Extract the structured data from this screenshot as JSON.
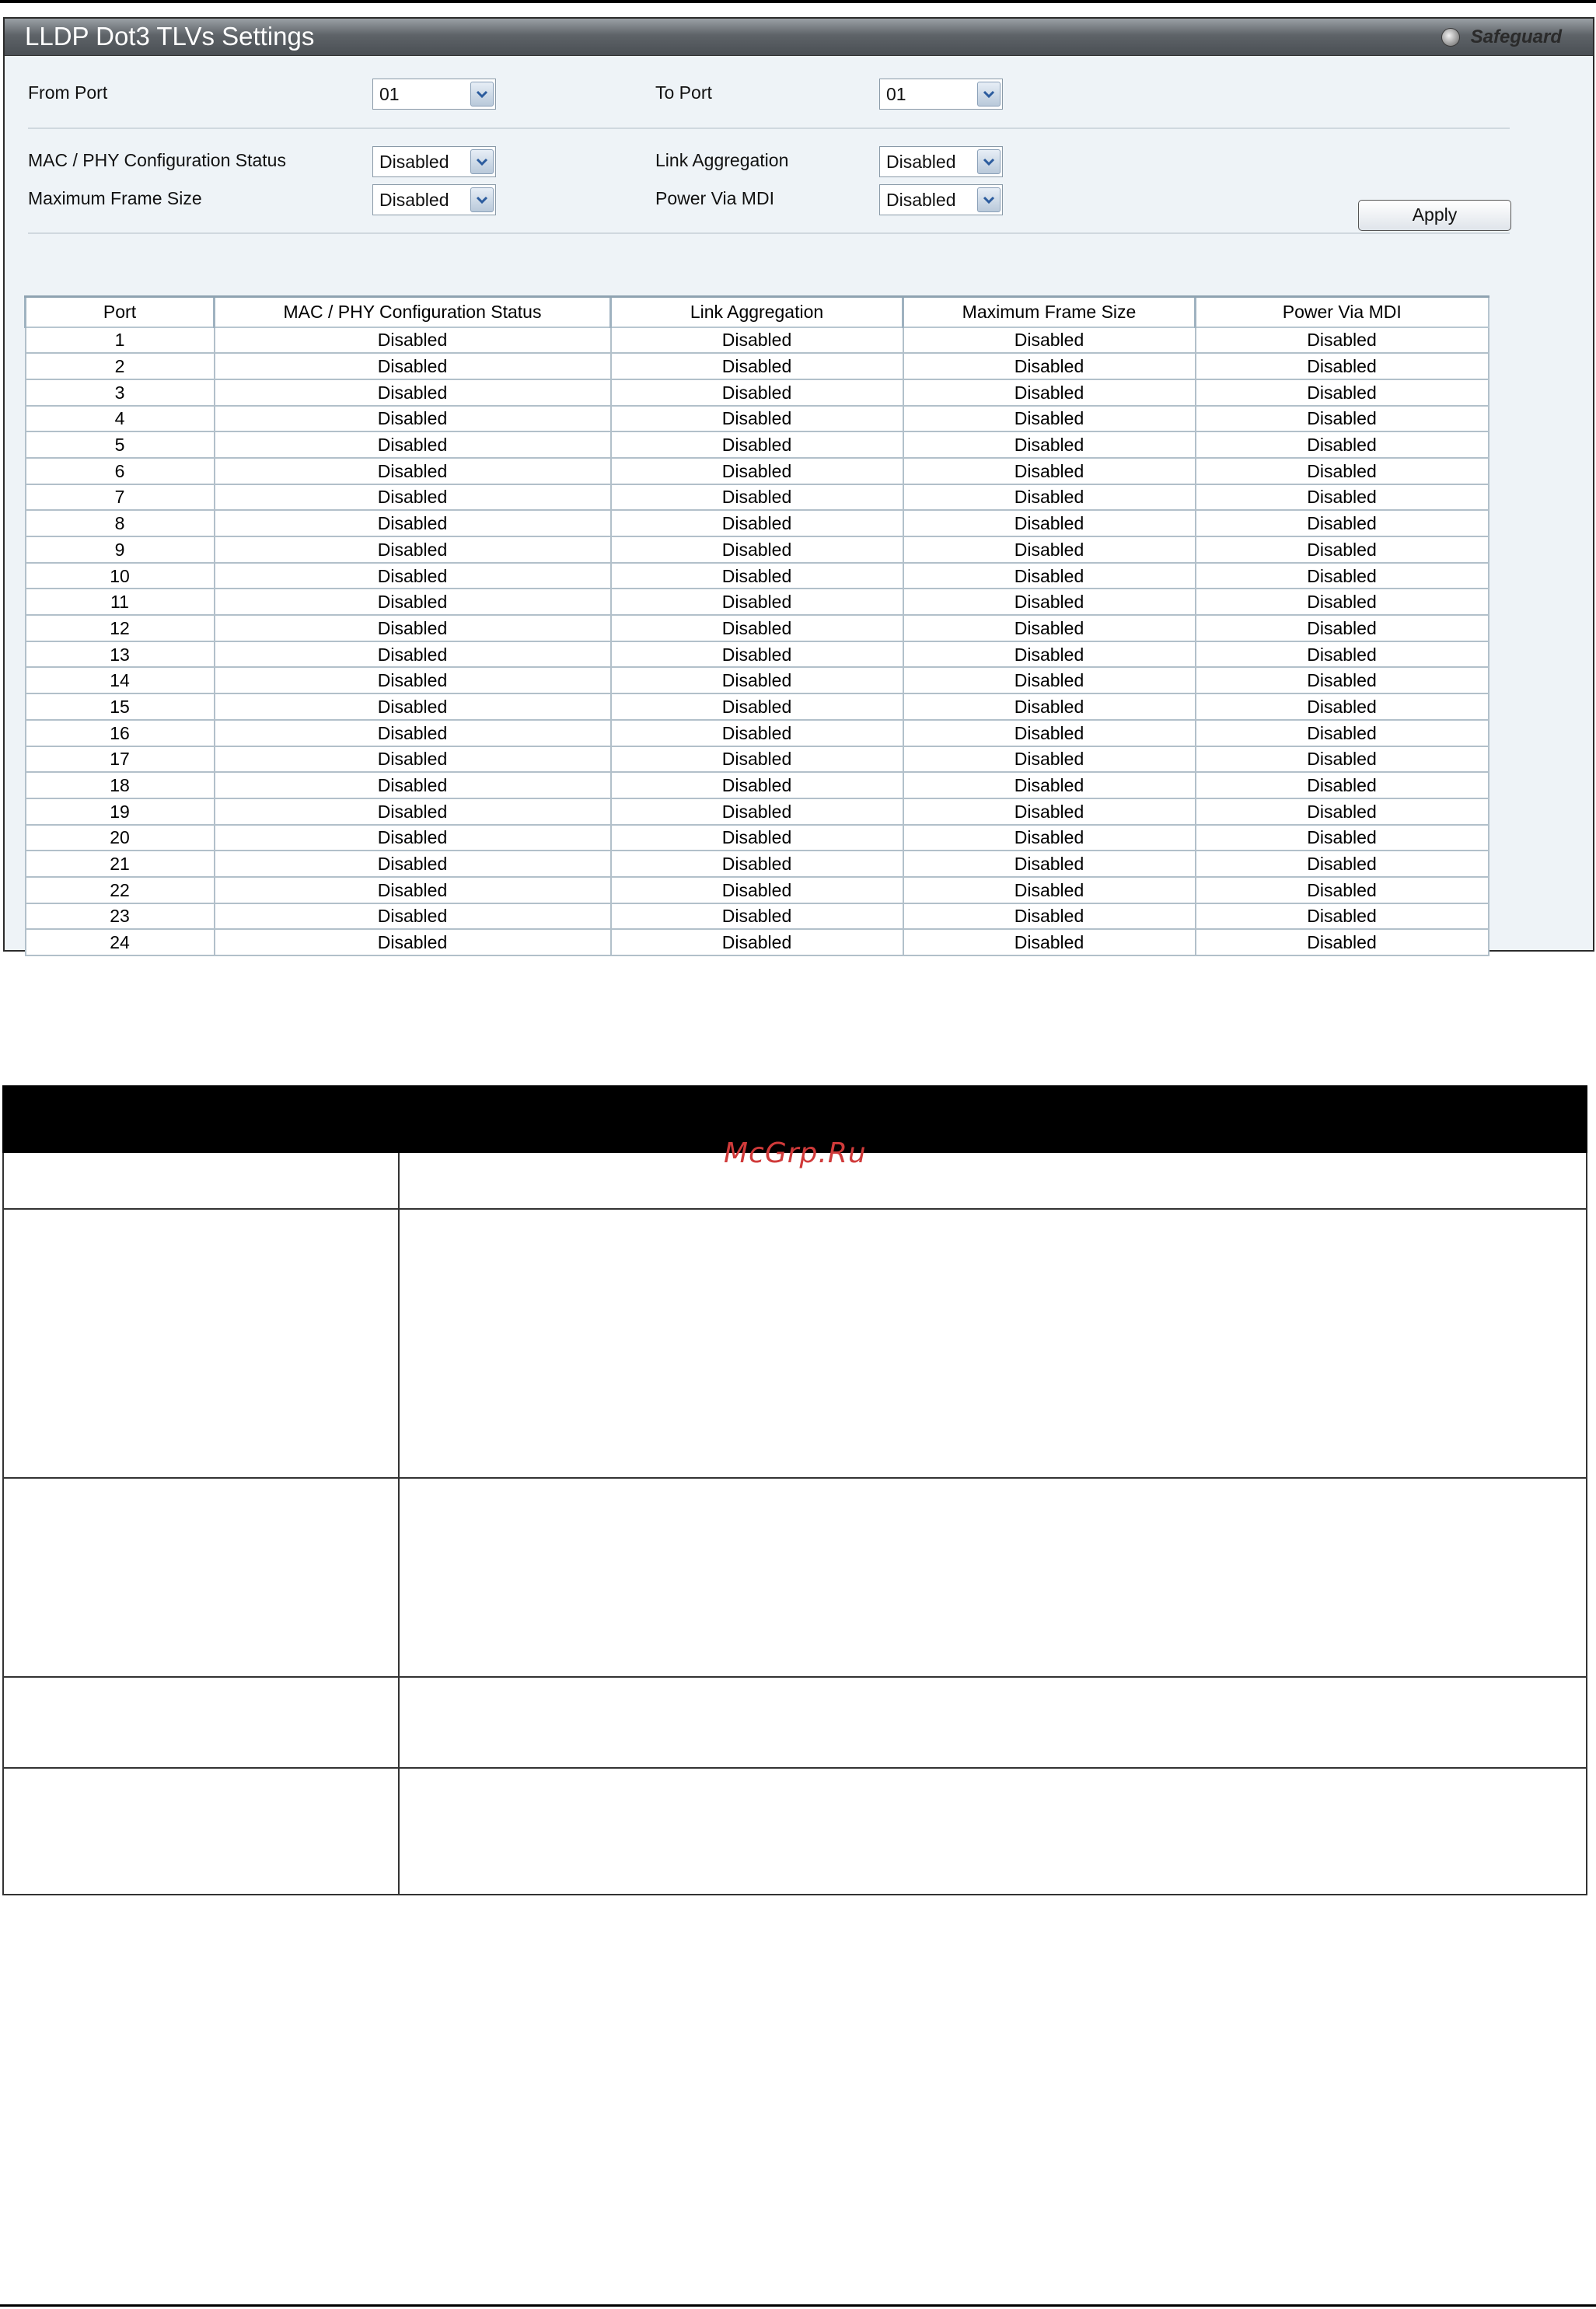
{
  "window": {
    "title": "LLDP Dot3 TLVs Settings",
    "safeguard_label": "Safeguard"
  },
  "form": {
    "from_port": {
      "label": "From Port",
      "value": "01"
    },
    "to_port": {
      "label": "To Port",
      "value": "01"
    },
    "mac_phy": {
      "label": "MAC / PHY Configuration Status",
      "value": "Disabled"
    },
    "link_aggregation": {
      "label": "Link Aggregation",
      "value": "Disabled"
    },
    "max_frame_size": {
      "label": "Maximum Frame Size",
      "value": "Disabled"
    },
    "power_via_mdi": {
      "label": "Power Via MDI",
      "value": "Disabled"
    },
    "apply_label": "Apply"
  },
  "table": {
    "headers": [
      "Port",
      "MAC / PHY Configuration Status",
      "Link Aggregation",
      "Maximum Frame Size",
      "Power Via MDI"
    ],
    "rows": [
      [
        "1",
        "Disabled",
        "Disabled",
        "Disabled",
        "Disabled"
      ],
      [
        "2",
        "Disabled",
        "Disabled",
        "Disabled",
        "Disabled"
      ],
      [
        "3",
        "Disabled",
        "Disabled",
        "Disabled",
        "Disabled"
      ],
      [
        "4",
        "Disabled",
        "Disabled",
        "Disabled",
        "Disabled"
      ],
      [
        "5",
        "Disabled",
        "Disabled",
        "Disabled",
        "Disabled"
      ],
      [
        "6",
        "Disabled",
        "Disabled",
        "Disabled",
        "Disabled"
      ],
      [
        "7",
        "Disabled",
        "Disabled",
        "Disabled",
        "Disabled"
      ],
      [
        "8",
        "Disabled",
        "Disabled",
        "Disabled",
        "Disabled"
      ],
      [
        "9",
        "Disabled",
        "Disabled",
        "Disabled",
        "Disabled"
      ],
      [
        "10",
        "Disabled",
        "Disabled",
        "Disabled",
        "Disabled"
      ],
      [
        "11",
        "Disabled",
        "Disabled",
        "Disabled",
        "Disabled"
      ],
      [
        "12",
        "Disabled",
        "Disabled",
        "Disabled",
        "Disabled"
      ],
      [
        "13",
        "Disabled",
        "Disabled",
        "Disabled",
        "Disabled"
      ],
      [
        "14",
        "Disabled",
        "Disabled",
        "Disabled",
        "Disabled"
      ],
      [
        "15",
        "Disabled",
        "Disabled",
        "Disabled",
        "Disabled"
      ],
      [
        "16",
        "Disabled",
        "Disabled",
        "Disabled",
        "Disabled"
      ],
      [
        "17",
        "Disabled",
        "Disabled",
        "Disabled",
        "Disabled"
      ],
      [
        "18",
        "Disabled",
        "Disabled",
        "Disabled",
        "Disabled"
      ],
      [
        "19",
        "Disabled",
        "Disabled",
        "Disabled",
        "Disabled"
      ],
      [
        "20",
        "Disabled",
        "Disabled",
        "Disabled",
        "Disabled"
      ],
      [
        "21",
        "Disabled",
        "Disabled",
        "Disabled",
        "Disabled"
      ],
      [
        "22",
        "Disabled",
        "Disabled",
        "Disabled",
        "Disabled"
      ],
      [
        "23",
        "Disabled",
        "Disabled",
        "Disabled",
        "Disabled"
      ],
      [
        "24",
        "Disabled",
        "Disabled",
        "Disabled",
        "Disabled"
      ]
    ]
  },
  "watermark": "McGrp.Ru"
}
